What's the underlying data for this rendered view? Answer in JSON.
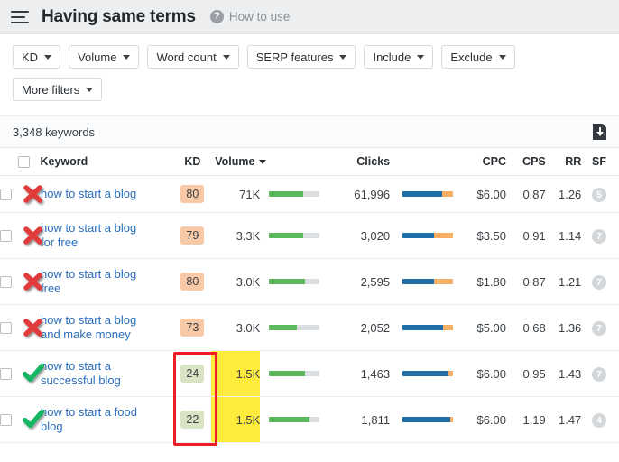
{
  "header": {
    "menu_icon": "hamburger-icon",
    "title": "Having same terms",
    "help_icon": "question-circle-icon",
    "help_label": "How to use"
  },
  "filters": {
    "row1": [
      {
        "label": "KD",
        "name": "filter-kd"
      },
      {
        "label": "Volume",
        "name": "filter-volume"
      },
      {
        "label": "Word count",
        "name": "filter-word-count"
      },
      {
        "label": "SERP features",
        "name": "filter-serp-features"
      },
      {
        "label": "Include",
        "name": "filter-include"
      },
      {
        "label": "Exclude",
        "name": "filter-exclude"
      }
    ],
    "row2": [
      {
        "label": "More filters",
        "name": "filter-more-filters"
      }
    ]
  },
  "toolbar": {
    "count_label": "3,348 keywords",
    "export_icon": "download-icon"
  },
  "table": {
    "columns": [
      {
        "label": "Keyword",
        "name": "col-keyword"
      },
      {
        "label": "KD",
        "name": "col-kd"
      },
      {
        "label": "Volume",
        "name": "col-volume",
        "sorted": true
      },
      {
        "label": "Clicks",
        "name": "col-clicks"
      },
      {
        "label": "CPC",
        "name": "col-cpc"
      },
      {
        "label": "CPS",
        "name": "col-cps"
      },
      {
        "label": "RR",
        "name": "col-rr"
      },
      {
        "label": "SF",
        "name": "col-sf"
      }
    ],
    "rows": [
      {
        "keyword": "how to start a blog",
        "mark": "red-x-icon",
        "kd": "80",
        "kd_level": "hard",
        "volume": "71K",
        "volume_highlight": false,
        "volume_bar_pct": 68,
        "clicks": "61,996",
        "clicks_blue_pct": 79,
        "clicks_orange_pct": 21,
        "cpc": "$6.00",
        "cps": "0.87",
        "rr": "1.26",
        "sf": "5"
      },
      {
        "keyword": "how to start a blog for free",
        "mark": "red-x-icon",
        "kd": "79",
        "kd_level": "hard",
        "volume": "3.3K",
        "volume_highlight": false,
        "volume_bar_pct": 68,
        "clicks": "3,020",
        "clicks_blue_pct": 62,
        "clicks_orange_pct": 38,
        "cpc": "$3.50",
        "cps": "0.91",
        "rr": "1.14",
        "sf": "7"
      },
      {
        "keyword": "how to start a blog free",
        "mark": "red-x-icon",
        "kd": "80",
        "kd_level": "hard",
        "volume": "3.0K",
        "volume_highlight": false,
        "volume_bar_pct": 70,
        "clicks": "2,595",
        "clicks_blue_pct": 62,
        "clicks_orange_pct": 38,
        "cpc": "$1.80",
        "cps": "0.87",
        "rr": "1.21",
        "sf": "7"
      },
      {
        "keyword": "how to start a blog and make money",
        "mark": "red-x-icon",
        "kd": "73",
        "kd_level": "hard",
        "volume": "3.0K",
        "volume_highlight": false,
        "volume_bar_pct": 55,
        "clicks": "2,052",
        "clicks_blue_pct": 80,
        "clicks_orange_pct": 20,
        "cpc": "$5.00",
        "cps": "0.68",
        "rr": "1.36",
        "sf": "7"
      },
      {
        "keyword": "how to start a successful blog",
        "mark": "green-check-icon",
        "kd": "24",
        "kd_level": "easy",
        "volume": "1.5K",
        "volume_highlight": true,
        "volume_bar_pct": 70,
        "clicks": "1,463",
        "clicks_blue_pct": 90,
        "clicks_orange_pct": 10,
        "cpc": "$6.00",
        "cps": "0.95",
        "rr": "1.43",
        "sf": "7"
      },
      {
        "keyword": "how to start a food blog",
        "mark": "green-check-icon",
        "kd": "22",
        "kd_level": "easy",
        "volume": "1.5K",
        "volume_highlight": true,
        "volume_bar_pct": 80,
        "clicks": "1,811",
        "clicks_blue_pct": 95,
        "clicks_orange_pct": 5,
        "cpc": "$6.00",
        "cps": "1.19",
        "rr": "1.47",
        "sf": "4"
      }
    ]
  },
  "annotations": {
    "kd_highlight_box": {
      "name": "kd-annotation-box",
      "color": "#ee1c25"
    }
  },
  "colors": {
    "link": "#2a6ebb",
    "kd_hard_bg": "#f7c9a6",
    "kd_easy_bg": "#d8e4c4",
    "volume_highlight": "#ffeb3b",
    "bar_green": "#5cb85c",
    "bar_blue": "#1e6fa8",
    "bar_orange": "#f5ae63",
    "annotation_red": "#ee1c25"
  }
}
